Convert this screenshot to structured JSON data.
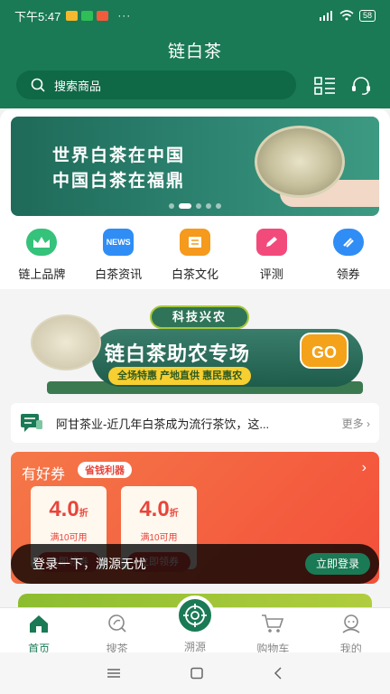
{
  "status_bar": {
    "time": "下午5:47",
    "battery": "58"
  },
  "header": {
    "title": "链白茶",
    "search_placeholder": "搜索商品"
  },
  "banner": {
    "line1": "世界白茶在中国",
    "line2": "中国白茶在福鼎",
    "dot_count": 5,
    "active_dot": 1
  },
  "nav": [
    {
      "label": "链上品牌",
      "icon": "crown-icon",
      "color": "#35c27a"
    },
    {
      "label": "白茶资讯",
      "icon": "news-icon",
      "color": "#2f8df5",
      "badge_text": "NEWS"
    },
    {
      "label": "白茶文化",
      "icon": "book-icon",
      "color": "#f59a1c"
    },
    {
      "label": "评测",
      "icon": "pencil-icon",
      "color": "#f34a7c"
    },
    {
      "label": "领券",
      "icon": "coupon-icon",
      "color": "#2f8df5"
    }
  ],
  "promo": {
    "badge": "科技兴农",
    "title": "链白茶助农专场",
    "go": "GO",
    "tags": "全场特惠  产地直供  惠民惠农"
  },
  "news": {
    "text": "阿甘茶业-近几年白茶成为流行茶饮，这...",
    "more": "更多"
  },
  "coupons": {
    "title": "有好券",
    "badge": "省钱利器",
    "items": [
      {
        "amount": "4.0",
        "unit": "折",
        "condition": "满10可用",
        "button": "立即领券"
      },
      {
        "amount": "4.0",
        "unit": "折",
        "condition": "满10可用",
        "button": "立即领券"
      }
    ]
  },
  "login_bar": {
    "text": "登录一下，溯源无忧",
    "button": "立即登录"
  },
  "tabs": [
    {
      "label": "首页",
      "icon": "home-icon",
      "active": true
    },
    {
      "label": "搜茶",
      "icon": "search-tea-icon",
      "active": false
    },
    {
      "label": "溯源",
      "icon": "target-icon",
      "active": false
    },
    {
      "label": "购物车",
      "icon": "cart-icon",
      "active": false
    },
    {
      "label": "我的",
      "icon": "profile-icon",
      "active": false
    }
  ],
  "colors": {
    "brand": "#1a7a55",
    "coupon_red": "#e8453b"
  }
}
